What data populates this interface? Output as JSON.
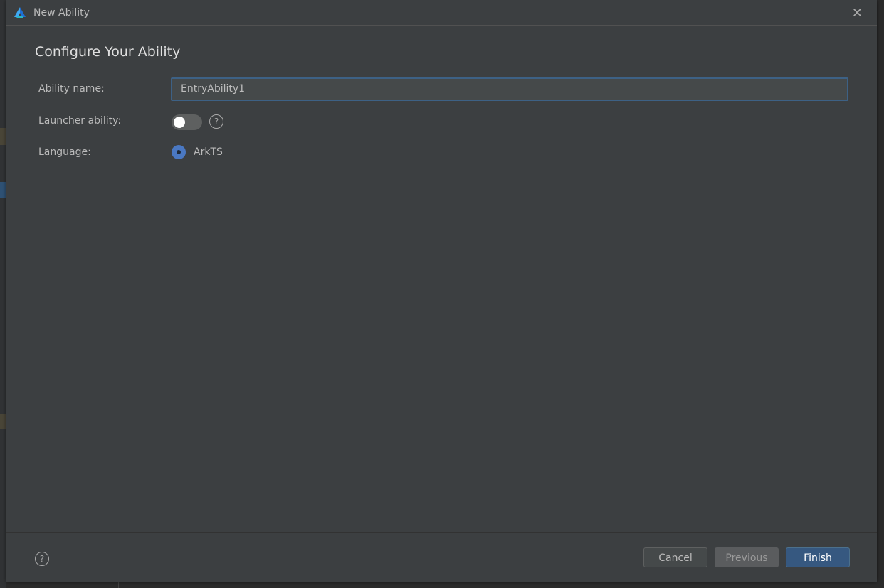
{
  "window": {
    "title": "New Ability",
    "logo_icon": "harmonyos-deveco-logo",
    "close_icon": "close-icon"
  },
  "page": {
    "heading": "Configure Your Ability"
  },
  "form": {
    "ability_name": {
      "label": "Ability name:",
      "value": "EntryAbility1"
    },
    "launcher_ability": {
      "label": "Launcher ability:",
      "enabled": false,
      "help": "?"
    },
    "language": {
      "label": "Language:",
      "selected": "ArkTS"
    }
  },
  "footer": {
    "help": "?",
    "cancel": "Cancel",
    "previous": "Previous",
    "finish": "Finish"
  },
  "colors": {
    "accent": "#365880",
    "background": "#3c3f41",
    "focus_border": "#3d6185"
  }
}
